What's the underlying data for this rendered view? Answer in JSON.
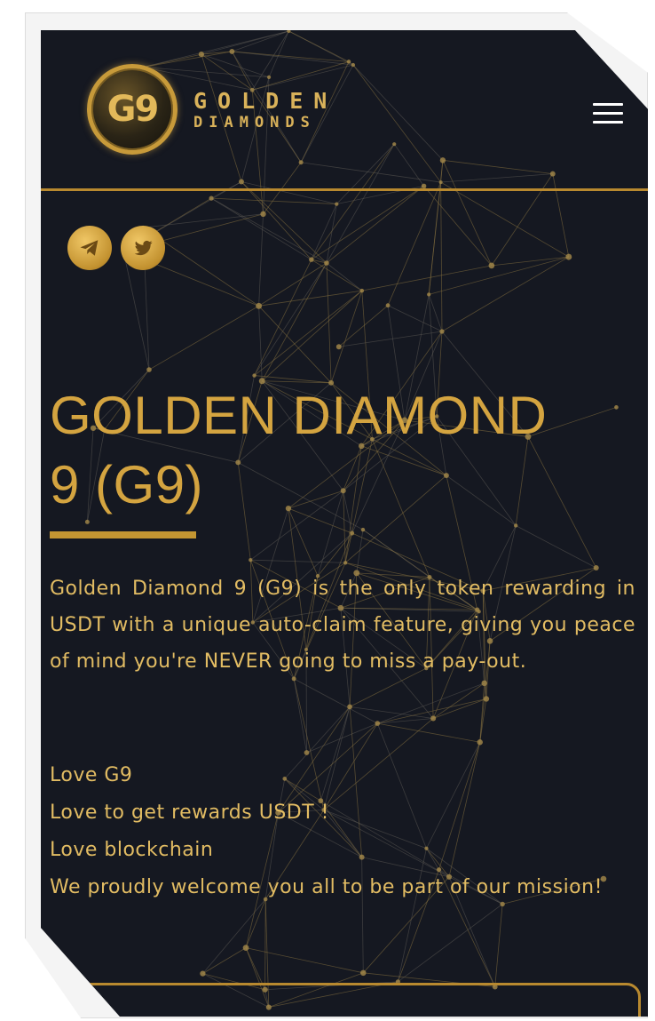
{
  "brand": {
    "logo_text": "G9",
    "name_line1": "GOLDEN",
    "name_line2": "DIAMONDS"
  },
  "header": {
    "menu_icon": "hamburger-menu-icon"
  },
  "social": [
    {
      "name": "telegram",
      "icon": "telegram-icon"
    },
    {
      "name": "twitter",
      "icon": "twitter-icon"
    }
  ],
  "hero": {
    "title_line1": "GOLDEN DIAMOND",
    "title_line2": "9 (G9)",
    "intro": "Golden Diamond 9 (G9) is the only token rewarding in USDT with a unique auto-claim feature, giving you peace of mind you're NEVER going to miss a pay-out.",
    "lines": [
      "Love G9",
      "Love to get rewards USDT !",
      "Love blockchain",
      "We proudly welcome you all to be part of our mission!"
    ]
  },
  "colors": {
    "background": "#151821",
    "gold": "#d4a440",
    "text_gold": "#e2bc63",
    "menu": "#ffffff"
  }
}
